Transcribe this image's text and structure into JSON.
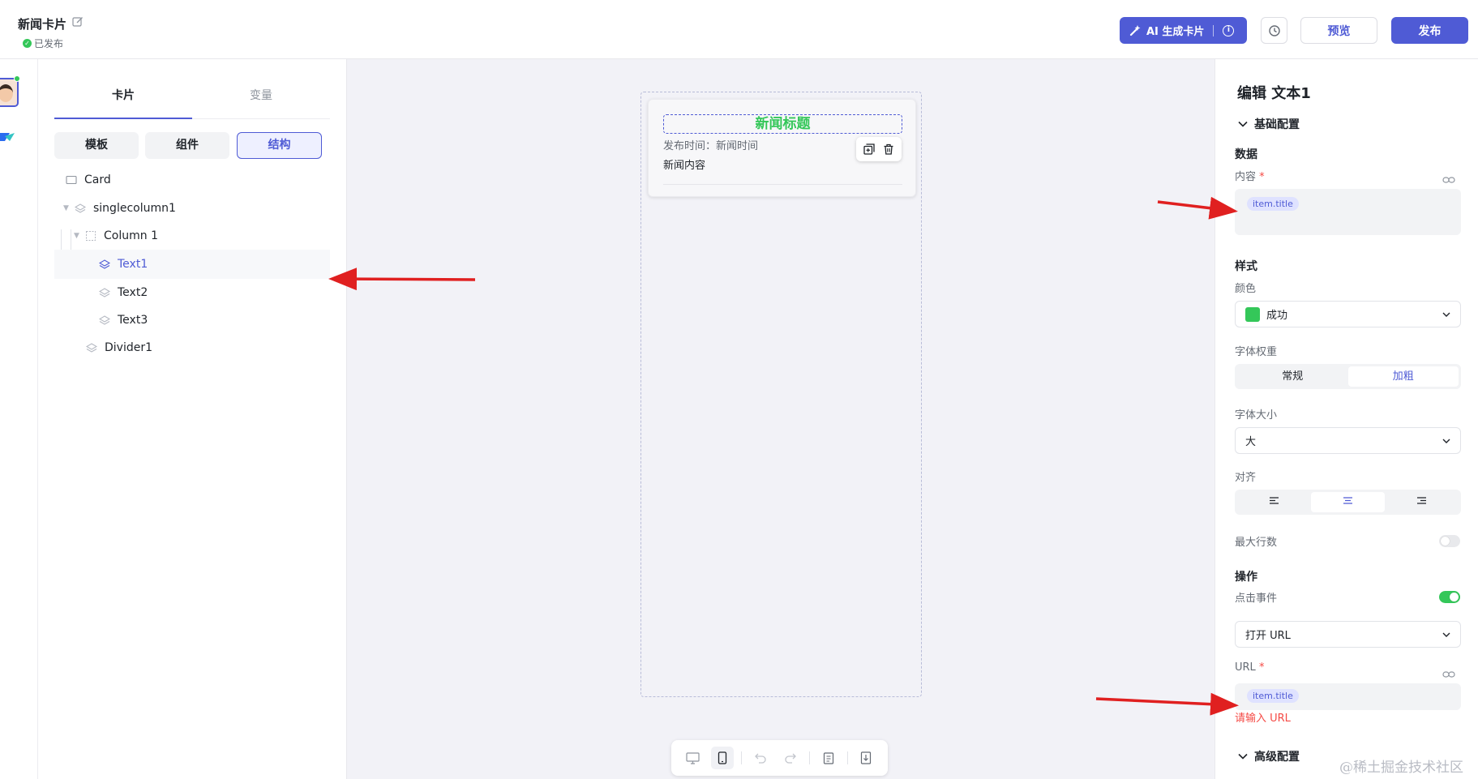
{
  "header": {
    "title": "新闻卡片",
    "status": "已发布",
    "ai_button": "AI 生成卡片",
    "preview": "预览",
    "publish": "发布"
  },
  "left_panel": {
    "tabs": [
      "卡片",
      "变量"
    ],
    "segments": [
      "模板",
      "组件",
      "结构"
    ],
    "active_segment": "结构",
    "tree": [
      {
        "label": "Card",
        "icon": "card-icon"
      },
      {
        "label": "singlecolumn1",
        "icon": "layers-icon"
      },
      {
        "label": "Column 1",
        "icon": "column-icon"
      },
      {
        "label": "Text1",
        "icon": "layers-icon",
        "selected": true
      },
      {
        "label": "Text2",
        "icon": "layers-icon"
      },
      {
        "label": "Text3",
        "icon": "layers-icon"
      },
      {
        "label": "Divider1",
        "icon": "layers-icon"
      }
    ]
  },
  "canvas": {
    "card": {
      "title": "新闻标题",
      "time": "发布时间：新闻时间",
      "body": "新闻内容"
    },
    "toolbar": [
      "desktop-icon",
      "mobile-icon",
      "undo-icon",
      "redo-icon",
      "clipboard-icon",
      "export-icon"
    ]
  },
  "props": {
    "heading": "编辑 文本1",
    "basic_section": "基础配置",
    "data_group": "数据",
    "content_label": "内容",
    "required_mark": "*",
    "content_value": "item.title",
    "style_group": "样式",
    "color_label": "颜色",
    "color_value": "成功",
    "color_swatch": "#34c759",
    "weight_label": "字体权重",
    "weight_options": [
      "常规",
      "加粗"
    ],
    "weight_selected": "加粗",
    "size_label": "字体大小",
    "size_value": "大",
    "align_label": "对齐",
    "align_options": [
      "align-left-icon",
      "align-center-icon",
      "align-right-icon"
    ],
    "align_selected": "align-center-icon",
    "max_lines_label": "最大行数",
    "max_lines_enabled": false,
    "action_group": "操作",
    "click_label": "点击事件",
    "click_enabled": true,
    "action_value": "打开 URL",
    "url_label": "URL",
    "url_value": "item.title",
    "url_error": "请输入 URL",
    "advanced_section": "高级配置"
  },
  "watermark": "@稀土掘金技术社区",
  "colors": {
    "accent": "#4f5bd5",
    "success": "#34c759",
    "error": "#f54a45",
    "annotation": "#e02020"
  }
}
